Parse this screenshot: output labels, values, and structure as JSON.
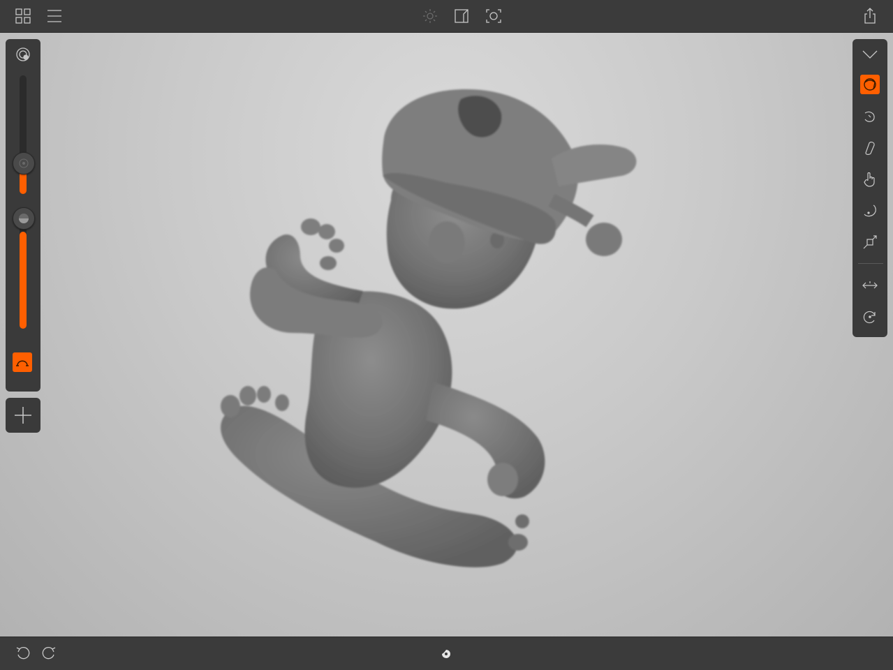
{
  "colors": {
    "accent": "#ff5f00",
    "bar": "#3b3b3b",
    "panel": "#3a3a3a",
    "icon": "#c8c8c8"
  },
  "topbar": {
    "left_icons": [
      "grid-icon",
      "menu-icon"
    ],
    "center_icons": [
      "light-icon",
      "camera-view-icon",
      "screenshot-icon"
    ],
    "right_icons": [
      "share-icon"
    ]
  },
  "left_panel": {
    "brush_settings_icon": "brush-settings-icon",
    "radius_slider_level": 0.33,
    "intensity_slider_level": 0.82,
    "falloff_button_active": true,
    "add_button_icon": "plus-icon"
  },
  "right_panel": {
    "collapse_icon": "chevron-down-icon",
    "tools": [
      {
        "name": "clay-tool",
        "active": true
      },
      {
        "name": "smooth-tool",
        "active": false
      },
      {
        "name": "flatten-tool",
        "active": false
      },
      {
        "name": "move-tool",
        "active": false
      },
      {
        "name": "inflate-tool",
        "active": false
      },
      {
        "name": "transform-tool",
        "active": false
      }
    ],
    "extra_tools": [
      "symmetry-tool",
      "rotate-tool"
    ]
  },
  "bottombar": {
    "left_icons": [
      "undo-icon",
      "redo-icon"
    ],
    "center_icon": "loading-spinner-icon"
  },
  "viewport": {
    "model": "sculpted-character"
  }
}
